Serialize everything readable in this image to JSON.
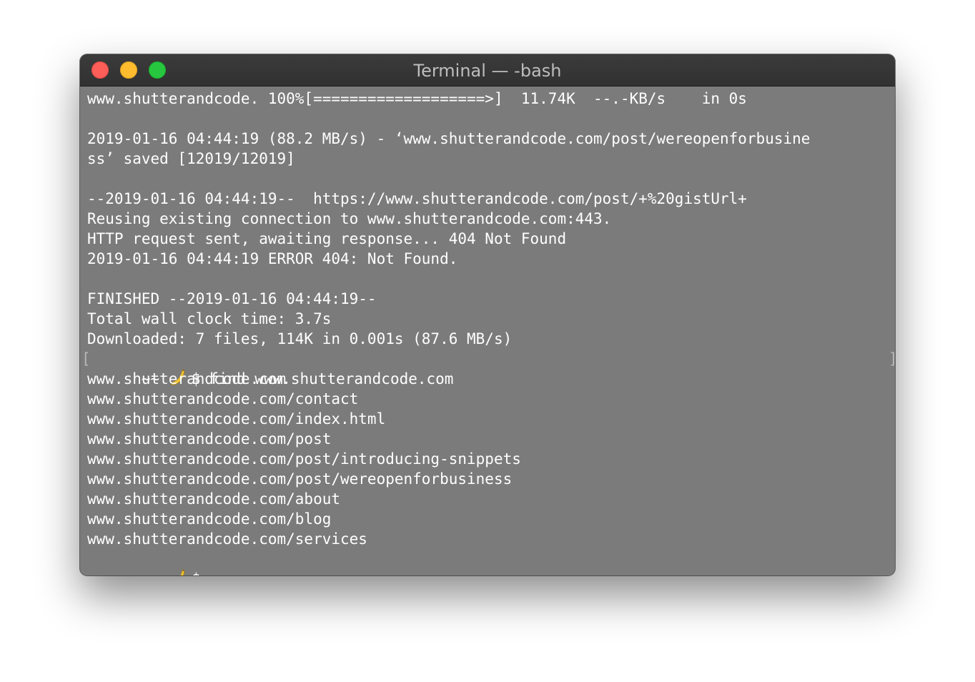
{
  "window": {
    "title": "Terminal — -bash"
  },
  "terminal": {
    "lines": [
      "www.shutterandcode. 100%[===================>]  11.74K  --.-KB/s    in 0s",
      "",
      "2019-01-16 04:44:19 (88.2 MB/s) - ‘www.shutterandcode.com/post/wereopenforbusine",
      "ss’ saved [12019/12019]",
      "",
      "--2019-01-16 04:44:19--  https://www.shutterandcode.com/post/+%20gistUrl+",
      "Reusing existing connection to www.shutterandcode.com:443.",
      "HTTP request sent, awaiting response... 404 Not Found",
      "2019-01-16 04:44:19 ERROR 404: Not Found.",
      "",
      "FINISHED --2019-01-16 04:44:19--",
      "Total wall clock time: 3.7s",
      "Downloaded: 7 files, 114K in 0.001s (87.6 MB/s)"
    ],
    "prompt1": {
      "bracket_left": "[",
      "prefix": "~~ ",
      "command": "$ find www.shutterandcode.com",
      "bracket_right": "]"
    },
    "output": [
      "www.shutterandcode.com",
      "www.shutterandcode.com/contact",
      "www.shutterandcode.com/index.html",
      "www.shutterandcode.com/post",
      "www.shutterandcode.com/post/introducing-snippets",
      "www.shutterandcode.com/post/wereopenforbusiness",
      "www.shutterandcode.com/about",
      "www.shutterandcode.com/blog",
      "www.shutterandcode.com/services"
    ],
    "prompt2": {
      "prefix": "~~ ",
      "command": "$ "
    },
    "prompt_icon": "banana-icon"
  },
  "colors": {
    "terminal_bg": "#7b7b7b",
    "titlebar_bg": "#353535",
    "text": "#ffffff",
    "close": "#fd5e57",
    "minimize": "#febc2e",
    "zoom": "#27c840"
  }
}
